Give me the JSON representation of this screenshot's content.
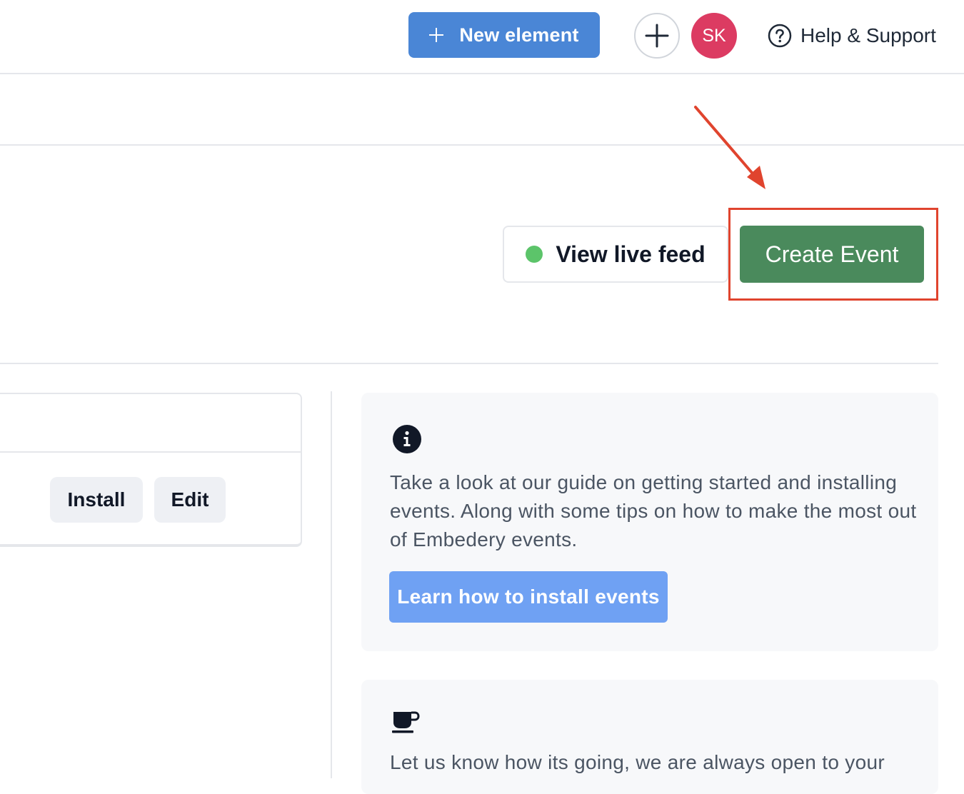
{
  "header": {
    "new_element_label": "New element",
    "avatar_initials": "SK",
    "help_label": "Help & Support"
  },
  "actions": {
    "view_live_feed_label": "View live feed",
    "create_event_label": "Create Event"
  },
  "element_card": {
    "install_label": "Install",
    "edit_label": "Edit"
  },
  "info_panel": {
    "text": "Take a look at our guide on getting started and installing events. Along with some tips on how to make the most out of Embedery events.",
    "button_label": "Learn how to install events"
  },
  "feedback_panel": {
    "text": "Let us know how its going, we are always open to your"
  },
  "colors": {
    "primary_blue": "#4a86d6",
    "create_green": "#4a8a5c",
    "avatar_pink": "#dc3b62",
    "live_dot_green": "#5cc46a",
    "annotation_red": "#e0442e",
    "learn_button_blue": "#6fa1f3"
  },
  "icons": {
    "new_element": "plus-icon",
    "add": "plus-icon",
    "help": "question-circle-icon",
    "live": "live-status-dot",
    "info": "info-circle-icon",
    "feedback": "coffee-cup-icon",
    "annotation": "arrow-pointer"
  }
}
